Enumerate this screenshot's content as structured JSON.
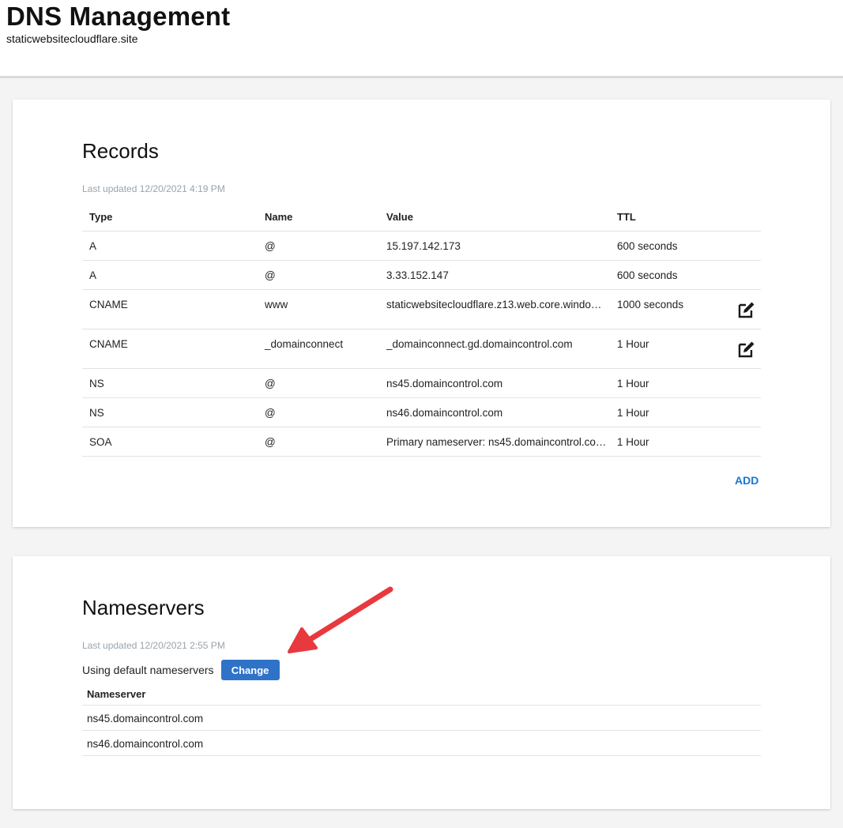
{
  "header": {
    "title": "DNS Management",
    "domain": "staticwebsitecloudflare.site"
  },
  "records": {
    "title": "Records",
    "last_updated": "Last updated 12/20/2021 4:19 PM",
    "columns": {
      "type": "Type",
      "name": "Name",
      "value": "Value",
      "ttl": "TTL"
    },
    "rows": [
      {
        "type": "A",
        "name": "@",
        "value": "15.197.142.173",
        "ttl": "600 seconds",
        "editable": false
      },
      {
        "type": "A",
        "name": "@",
        "value": "3.33.152.147",
        "ttl": "600 seconds",
        "editable": false
      },
      {
        "type": "CNAME",
        "name": "www",
        "value": "staticwebsitecloudflare.z13.web.core.windows…",
        "ttl": "1000 seconds",
        "editable": true
      },
      {
        "type": "CNAME",
        "name": "_domainconnect",
        "value": "_domainconnect.gd.domaincontrol.com",
        "ttl": "1 Hour",
        "editable": true
      },
      {
        "type": "NS",
        "name": "@",
        "value": "ns45.domaincontrol.com",
        "ttl": "1 Hour",
        "editable": false
      },
      {
        "type": "NS",
        "name": "@",
        "value": "ns46.domaincontrol.com",
        "ttl": "1 Hour",
        "editable": false
      },
      {
        "type": "SOA",
        "name": "@",
        "value": "Primary nameserver: ns45.domaincontrol.co…",
        "ttl": "1 Hour",
        "editable": false
      }
    ],
    "add_label": "ADD"
  },
  "nameservers": {
    "title": "Nameservers",
    "last_updated": "Last updated 12/20/2021 2:55 PM",
    "using_text": "Using default nameservers",
    "change_label": "Change",
    "column": "Nameserver",
    "rows": [
      "ns45.domaincontrol.com",
      "ns46.domaincontrol.com"
    ]
  },
  "colors": {
    "accent": "#1976d2",
    "button": "#2f73c9",
    "annotation_arrow": "#e8393e",
    "muted_text": "#9aa3ab"
  },
  "icons": {
    "edit": "edit-square-pencil-icon"
  }
}
